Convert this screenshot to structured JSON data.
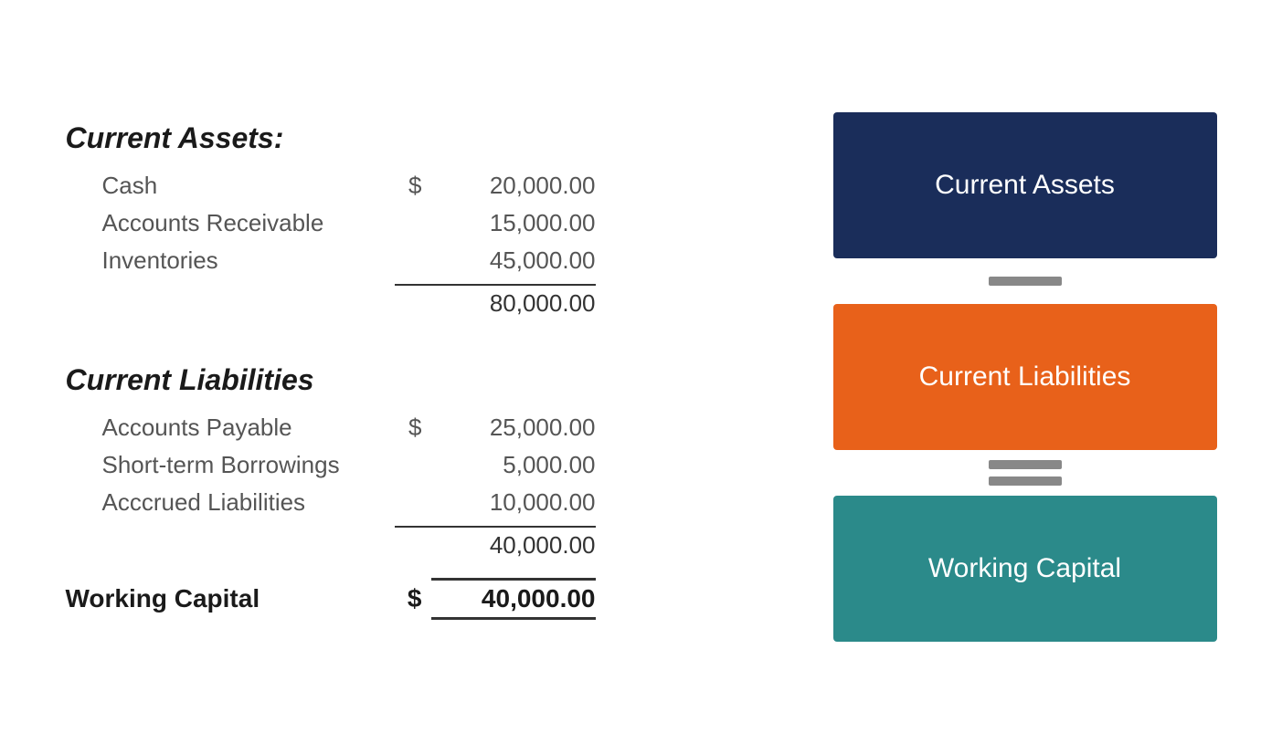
{
  "current_assets": {
    "heading": "Current Assets:",
    "items": [
      {
        "label": "Cash",
        "dollar": "$",
        "amount": "20,000.00"
      },
      {
        "label": "Accounts Receivable",
        "dollar": "",
        "amount": "15,000.00"
      },
      {
        "label": "Inventories",
        "dollar": "",
        "amount": "45,000.00"
      }
    ],
    "subtotal": "80,000.00"
  },
  "current_liabilities": {
    "heading": "Current Liabilities",
    "items": [
      {
        "label": "Accounts Payable",
        "dollar": "$",
        "amount": "25,000.00"
      },
      {
        "label": "Short-term Borrowings",
        "dollar": "",
        "amount": "5,000.00"
      },
      {
        "label": "Acccrued Liabilities",
        "dollar": "",
        "amount": "10,000.00"
      }
    ],
    "subtotal": "40,000.00"
  },
  "working_capital": {
    "label": "Working Capital",
    "dollar": "$",
    "amount": "40,000.00"
  },
  "right_panel": {
    "card1_label": "Current Assets",
    "card2_label": "Current Liabilities",
    "card3_label": "Working Capital",
    "card1_color": "#1a2d5a",
    "card2_color": "#e8611a",
    "card3_color": "#2b8a8a"
  }
}
